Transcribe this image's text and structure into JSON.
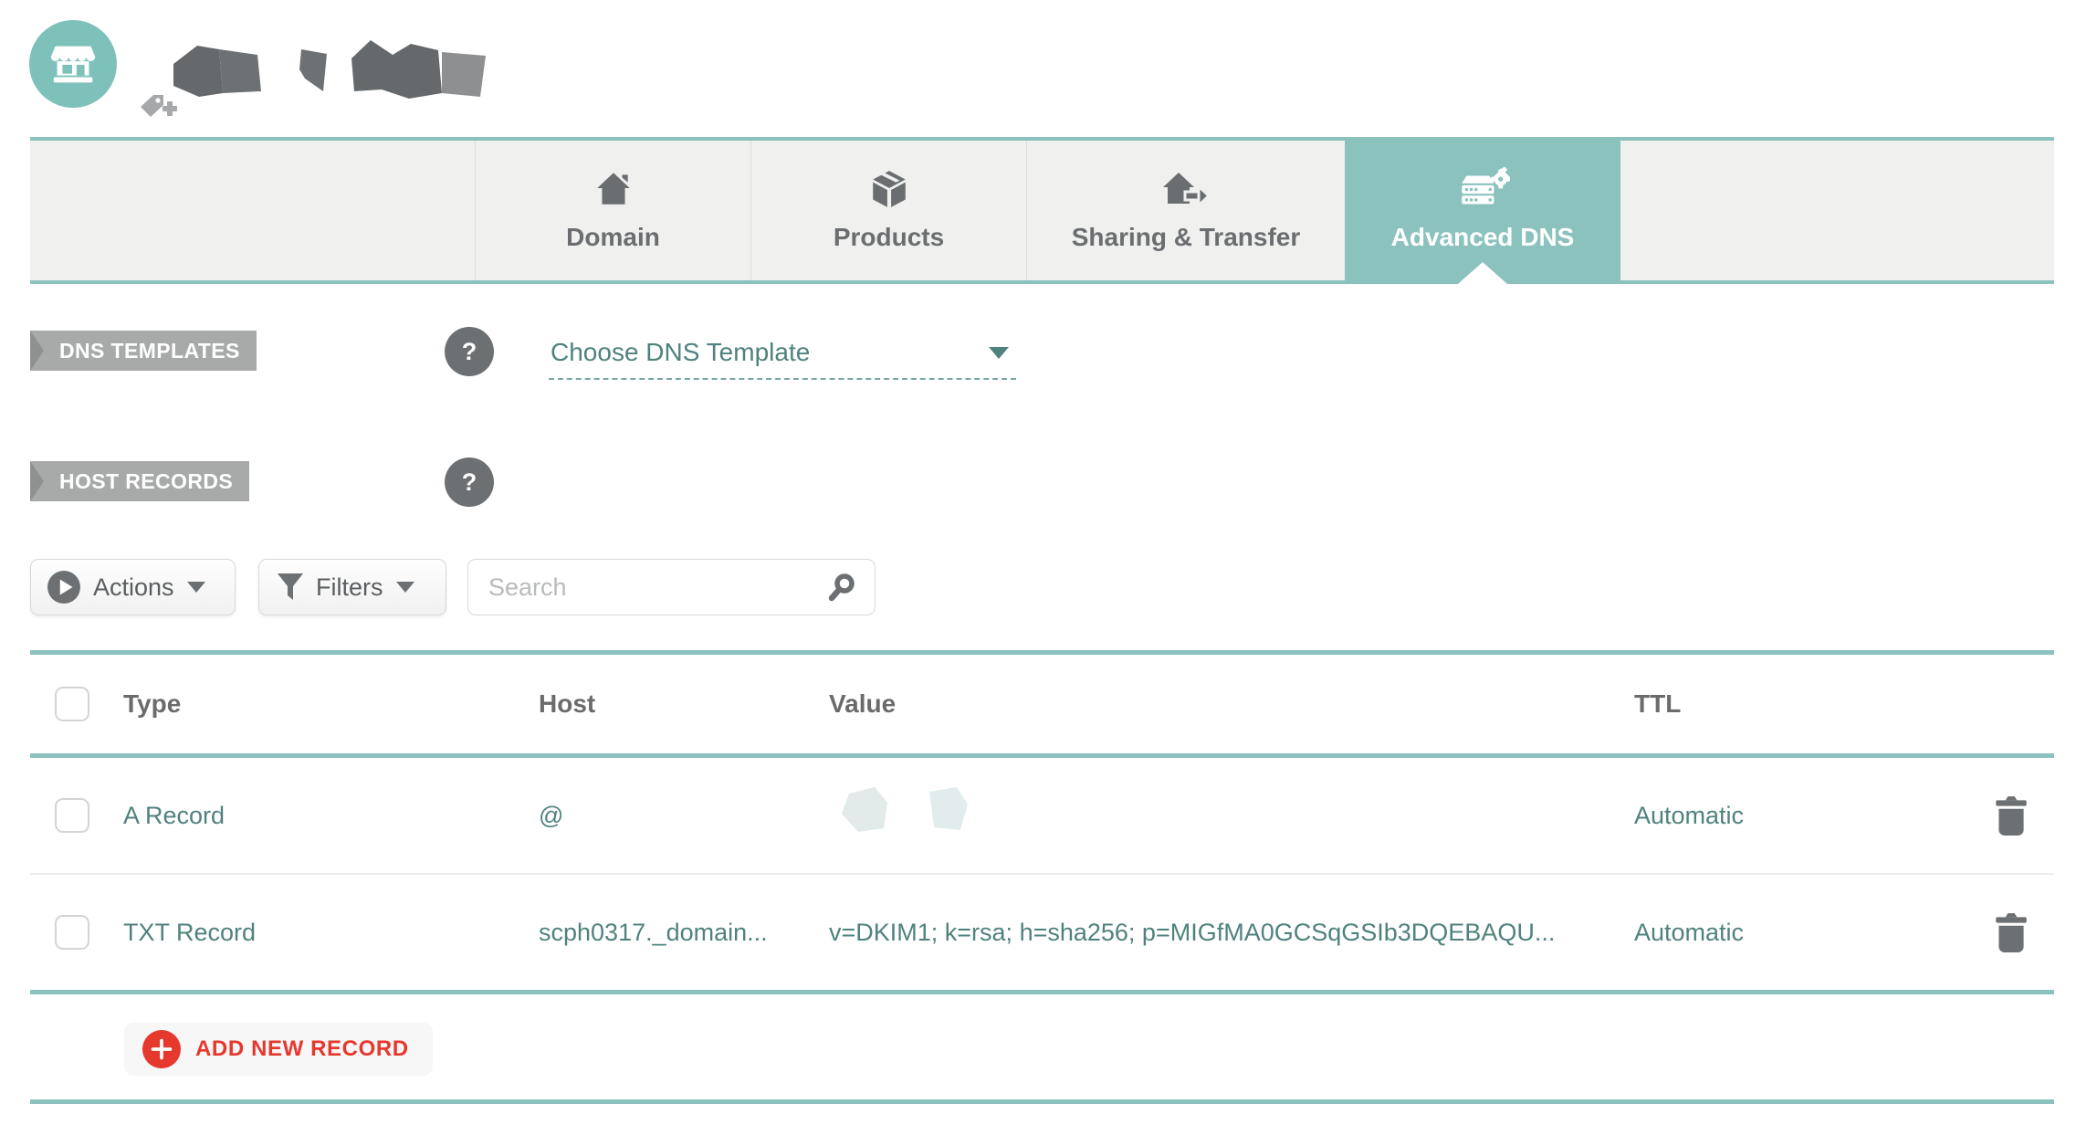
{
  "header": {
    "avatar_icon": "storefront-icon",
    "domain_name_redacted": true,
    "add_tag_icon": "tag-plus-icon"
  },
  "tabs": {
    "items": [
      {
        "label": "Domain",
        "icon": "house-icon",
        "active": false
      },
      {
        "label": "Products",
        "icon": "package-box-icon",
        "active": false
      },
      {
        "label": "Sharing & Transfer",
        "icon": "house-transfer-icon",
        "active": false
      },
      {
        "label": "Advanced DNS",
        "icon": "dns-server-gear-icon",
        "active": true
      }
    ]
  },
  "dns_templates": {
    "badge": "DNS TEMPLATES",
    "help": "?",
    "dropdown_label": "Choose DNS Template"
  },
  "host_records": {
    "badge": "HOST RECORDS",
    "help": "?"
  },
  "toolbar": {
    "actions_label": "Actions",
    "filters_label": "Filters",
    "search_placeholder": "Search"
  },
  "table": {
    "headers": {
      "type": "Type",
      "host": "Host",
      "value": "Value",
      "ttl": "TTL"
    },
    "rows": [
      {
        "type": "A Record",
        "host": "@",
        "value_redacted": true,
        "ttl": "Automatic"
      },
      {
        "type": "TXT Record",
        "host": "scph0317._domain...",
        "value": "v=DKIM1; k=rsa; h=sha256; p=MIGfMA0GCSqGSIb3DQEBAQU...",
        "ttl": "Automatic"
      }
    ]
  },
  "add_record": {
    "label": "ADD NEW RECORD"
  },
  "colors": {
    "accent_teal": "#8BC2BE",
    "avatar_teal": "#7EC1BB",
    "link_teal": "#4F827E",
    "danger_red": "#E6392E",
    "gray_text": "#6B6E70",
    "badge_gray": "#A8AAAA",
    "tab_bg": "#F0F0EF"
  }
}
